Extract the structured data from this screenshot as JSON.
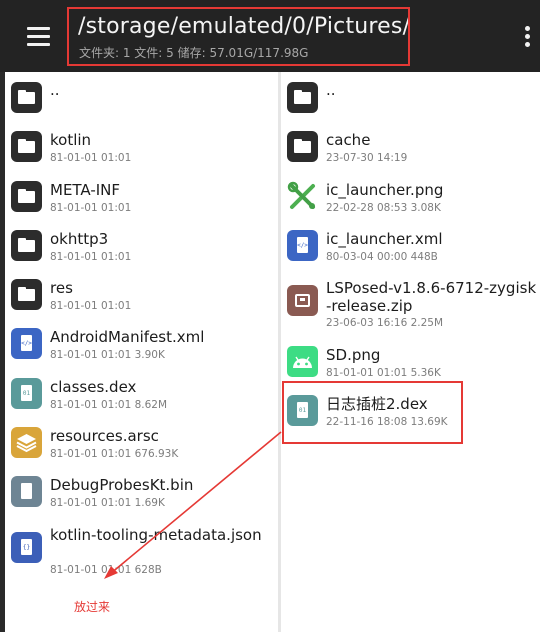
{
  "toolbar": {
    "path": "/storage/emulated/0/Pictures/",
    "stats": "文件夹: 1  文件: 5  储存: 57.01G/117.98G"
  },
  "left_pane": {
    "items": [
      {
        "name": "..",
        "meta": "",
        "type": "folder",
        "icon": "folder-icon"
      },
      {
        "name": "kotlin",
        "meta": "81-01-01 01:01",
        "type": "folder",
        "icon": "folder-icon"
      },
      {
        "name": "META-INF",
        "meta": "81-01-01 01:01",
        "type": "folder",
        "icon": "folder-icon"
      },
      {
        "name": "okhttp3",
        "meta": "81-01-01 01:01",
        "type": "folder",
        "icon": "folder-icon"
      },
      {
        "name": "res",
        "meta": "81-01-01 01:01",
        "type": "folder",
        "icon": "folder-icon"
      },
      {
        "name": "AndroidManifest.xml",
        "meta": "81-01-01 01:01  3.90K",
        "type": "xml",
        "icon": "xml-file-icon"
      },
      {
        "name": "classes.dex",
        "meta": "81-01-01 01:01  8.62M",
        "type": "dex",
        "icon": "dex-file-icon"
      },
      {
        "name": "resources.arsc",
        "meta": "81-01-01 01:01  676.93K",
        "type": "arsc",
        "icon": "layers-file-icon"
      },
      {
        "name": "DebugProbesKt.bin",
        "meta": "81-01-01 01:01  1.69K",
        "type": "bin",
        "icon": "binary-file-icon"
      },
      {
        "name": "kotlin-tooling-metadata.json",
        "meta": "81-01-01 01:01  628B",
        "type": "json",
        "icon": "json-file-icon"
      }
    ]
  },
  "right_pane": {
    "items": [
      {
        "name": "..",
        "meta": "",
        "type": "folder",
        "icon": "folder-icon"
      },
      {
        "name": "cache",
        "meta": "23-07-30 14:19",
        "type": "folder",
        "icon": "folder-icon"
      },
      {
        "name": "ic_launcher.png",
        "meta": "22-02-28 08:53  3.08K",
        "type": "png-tools",
        "icon": "tools-image-icon"
      },
      {
        "name": "ic_launcher.xml",
        "meta": "80-03-04 00:00  448B",
        "type": "xml",
        "icon": "xml-file-icon"
      },
      {
        "name": "LSPosed-v1.8.6-6712-zygisk-release.zip",
        "meta": "23-06-03 16:16  2.25M",
        "type": "zip",
        "icon": "zip-archive-icon"
      },
      {
        "name": "SD.png",
        "meta": "81-01-01 01:01  5.36K",
        "type": "png-android",
        "icon": "android-image-icon"
      },
      {
        "name": "日志插桩2.dex",
        "meta": "22-11-16 18:08  13.69K",
        "type": "dex",
        "icon": "dex-file-icon"
      }
    ]
  },
  "annotation": {
    "note": "放过来",
    "color": "#e53935"
  },
  "colors": {
    "toolbar_bg": "#232323",
    "folder_icon": "#2c2c2c",
    "xml_icon": "#3c66c4",
    "dex_icon": "#5a9a9a",
    "arsc_icon": "#d9a53a",
    "zip_icon": "#8a5a52"
  }
}
